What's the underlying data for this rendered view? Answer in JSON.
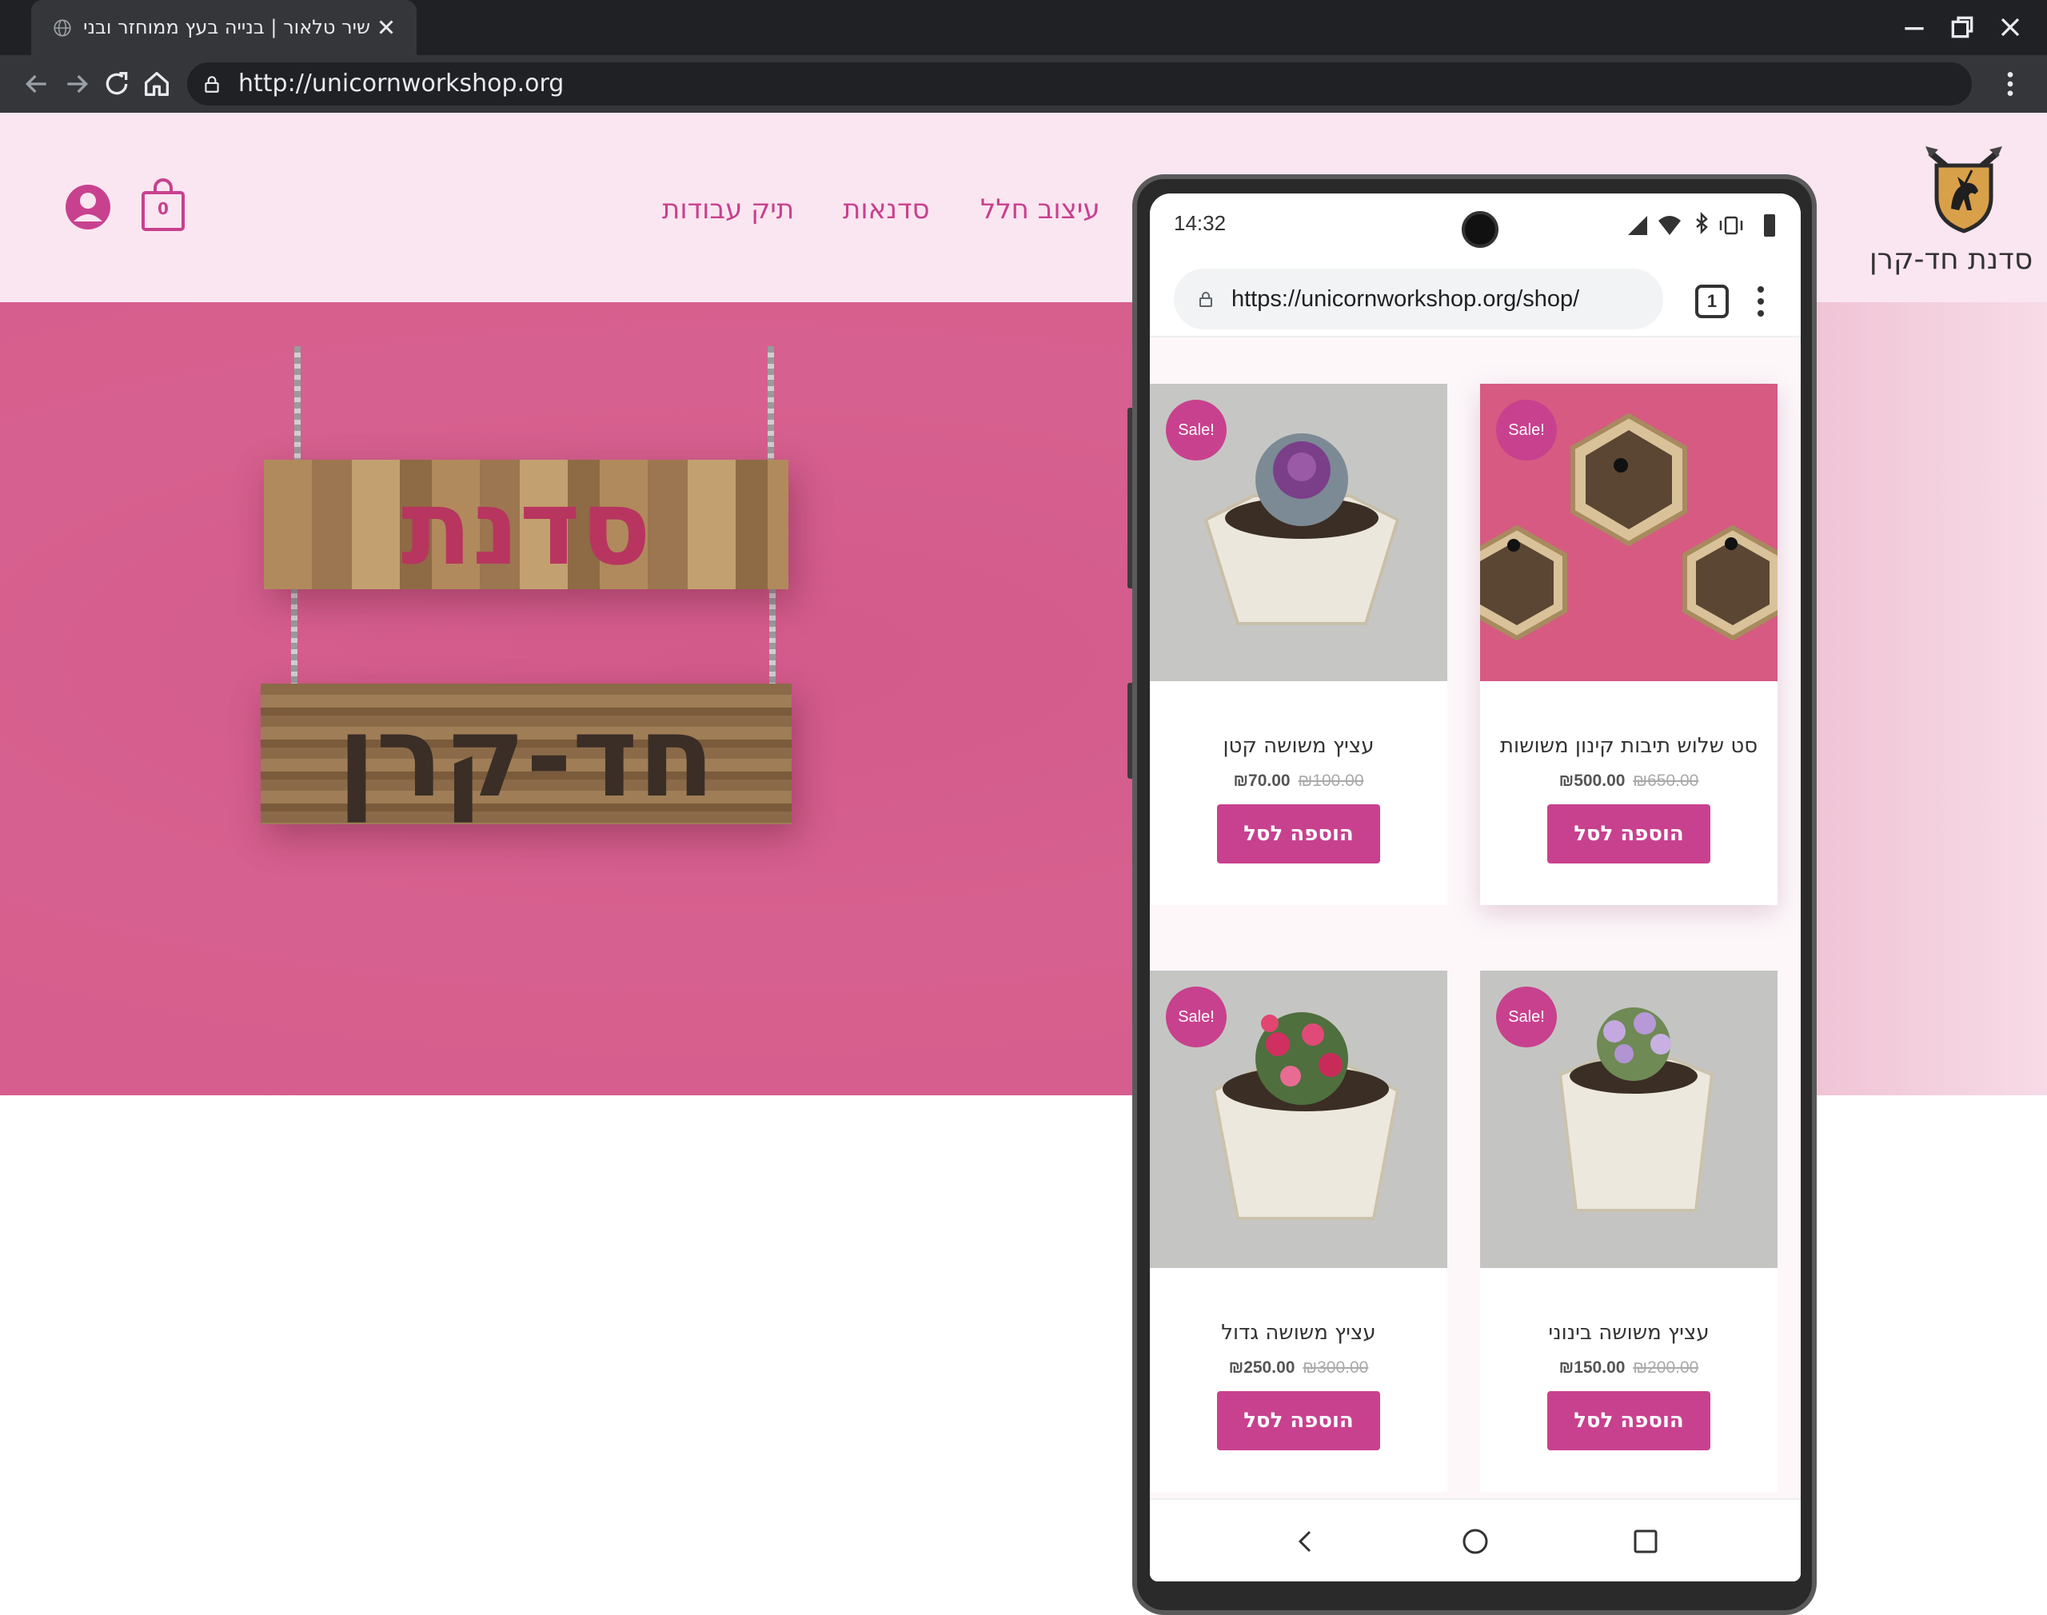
{
  "browser": {
    "tab_title": "שיר טלאור | בנייה בעץ ממוחזר ובנייה",
    "url": "http://unicornworkshop.org"
  },
  "site": {
    "name": "סדנת חד-קרן",
    "nav": [
      "עיצוב חלל",
      "סדנאות",
      "תיק עבודות"
    ],
    "cart_count": "0",
    "brand_color": "#c8418e",
    "hero_sign_top": "סדנת",
    "hero_sign_bottom": "חד-קרן"
  },
  "phone": {
    "time": "14:32",
    "url": "https://unicornworkshop.org/shop/",
    "tab_count": "1",
    "products": [
      {
        "title": "סט שלוש תיבות קינון משושות",
        "price_old": "₪650.00",
        "price_new": "₪500.00",
        "badge": "Sale!",
        "button": "הוספה לסל"
      },
      {
        "title": "עציץ משושה קטן",
        "price_old": "₪100.00",
        "price_new": "₪70.00",
        "badge": "Sale!",
        "button": "הוספה לסל"
      },
      {
        "title": "עציץ משושה בינוני",
        "price_old": "₪200.00",
        "price_new": "₪150.00",
        "badge": "Sale!",
        "button": "הוספה לסל"
      },
      {
        "title": "עציץ משושה גדול",
        "price_old": "₪300.00",
        "price_new": "₪250.00",
        "badge": "Sale!",
        "button": "הוספה לסל"
      }
    ]
  }
}
